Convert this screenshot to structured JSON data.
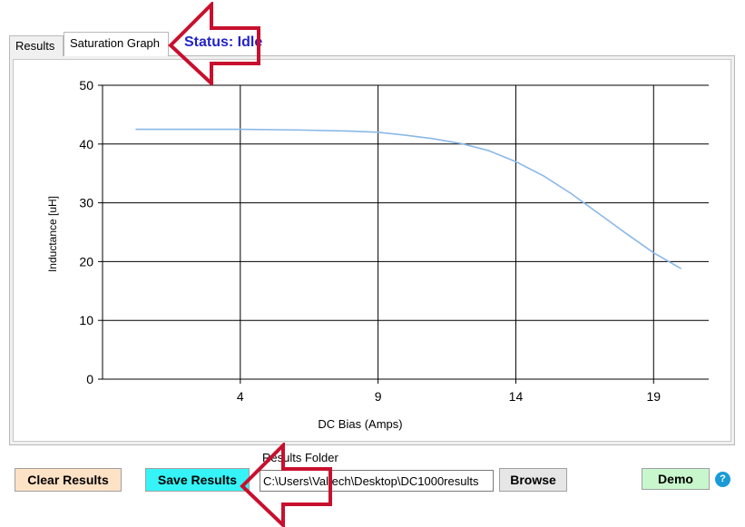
{
  "tabs": [
    {
      "label": "Results"
    },
    {
      "label": "Saturation Graph"
    }
  ],
  "status": {
    "text": "Status: Idle",
    "color": "#2323c8"
  },
  "chart_data": {
    "type": "line",
    "xlabel": "DC Bias (Amps)",
    "ylabel": "Inductance [uH]",
    "xticks": [
      4,
      9,
      14,
      19
    ],
    "yticks": [
      0,
      10,
      20,
      30,
      40,
      50
    ],
    "xlim": [
      -1,
      21
    ],
    "ylim": [
      0,
      50
    ],
    "grid": true,
    "legend": "none",
    "line_color": "#8ab8e8",
    "series": [
      {
        "x": [
          0.2,
          2,
          4,
          6,
          8,
          9,
          10,
          11,
          12,
          13,
          14,
          15,
          16,
          17,
          18,
          19,
          20
        ],
        "values": [
          42.5,
          42.5,
          42.5,
          42.4,
          42.2,
          42.0,
          41.5,
          40.9,
          40.1,
          38.9,
          37.0,
          34.6,
          31.6,
          28.2,
          24.8,
          21.5,
          18.8
        ]
      }
    ]
  },
  "buttons": {
    "clear": "Clear Results",
    "save": "Save Results",
    "browse": "Browse",
    "demo": "Demo",
    "help": "?"
  },
  "folder": {
    "label": "Results Folder",
    "value": "C:\\Users\\Valtech\\Desktop\\DC1000results"
  },
  "colors": {
    "annotation_arrow": "#c8102e",
    "clear_button": "#fde2c6",
    "save_button": "#35f3f7",
    "demo_button": "#c9f7cd",
    "help_icon": "#1a9bd7"
  }
}
